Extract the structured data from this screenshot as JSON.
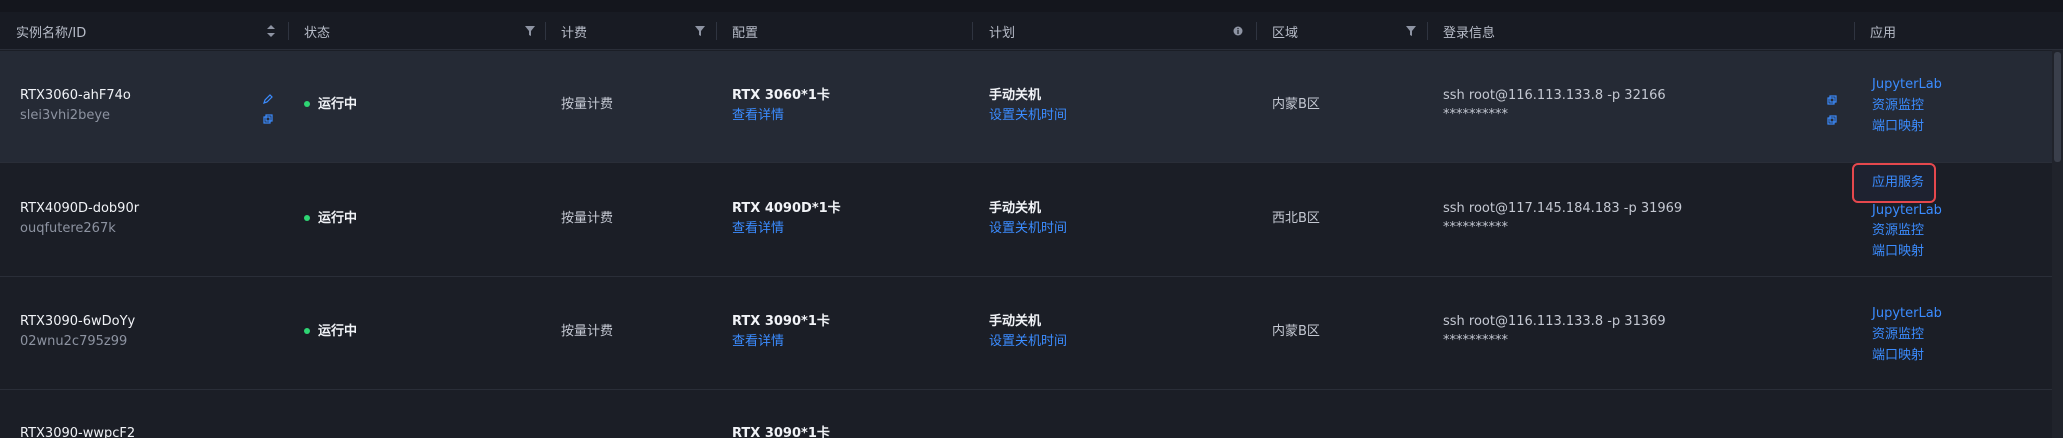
{
  "columns": {
    "name": "实例名称/ID",
    "status": "状态",
    "billing": "计费",
    "config": "配置",
    "plan": "计划",
    "region": "区域",
    "login": "登录信息",
    "app": "应用"
  },
  "rows": [
    {
      "name": "RTX3060-ahF74o",
      "id": "slei3vhi2beye",
      "status": "运行中",
      "billing": "按量计费",
      "config": "RTX 3060*1卡",
      "config_link": "查看详情",
      "plan": "手动关机",
      "plan_link": "设置关机时间",
      "region": "内蒙B区",
      "ssh": "ssh root@116.113.133.8 -p 32166",
      "password": "**********",
      "apps": [
        "JupyterLab",
        "资源监控",
        "端口映射"
      ]
    },
    {
      "name": "RTX4090D-dob90r",
      "id": "ouqfutere267k",
      "status": "运行中",
      "billing": "按量计费",
      "config": "RTX 4090D*1卡",
      "config_link": "查看详情",
      "plan": "手动关机",
      "plan_link": "设置关机时间",
      "region": "西北B区",
      "ssh": "ssh root@117.145.184.183 -p 31969",
      "password": "**********",
      "apps": [
        "JupyterLab",
        "资源监控",
        "端口映射"
      ]
    },
    {
      "name": "RTX3090-6wDoYy",
      "id": "02wnu2c795z99",
      "status": "运行中",
      "billing": "按量计费",
      "config": "RTX 3090*1卡",
      "config_link": "查看详情",
      "plan": "手动关机",
      "plan_link": "设置关机时间",
      "region": "内蒙B区",
      "ssh": "ssh root@116.113.133.8 -p 31369",
      "password": "**********",
      "apps": [
        "JupyterLab",
        "资源监控",
        "端口映射"
      ]
    },
    {
      "name": "RTX3090-wwpcF2",
      "config": "RTX 3090*1卡"
    }
  ],
  "popup": {
    "label": "应用服务"
  },
  "colors": {
    "accent": "#3b8cff",
    "running": "#2ed573",
    "highlight": "#e5484d"
  }
}
